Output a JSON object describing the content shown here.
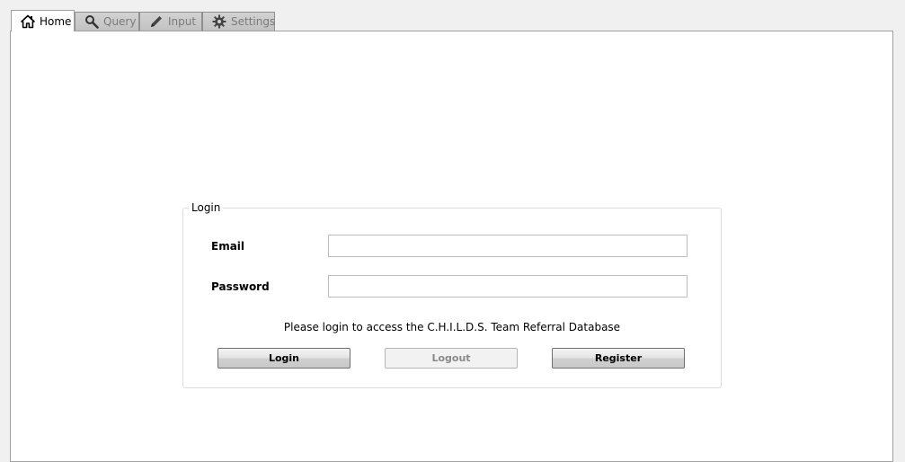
{
  "tabs": [
    {
      "label": "Home",
      "icon": "home-icon",
      "active": true
    },
    {
      "label": "Query",
      "icon": "search-icon",
      "active": false
    },
    {
      "label": "Input",
      "icon": "pencil-icon",
      "active": false
    },
    {
      "label": "Settings",
      "icon": "gear-icon",
      "active": false
    }
  ],
  "login": {
    "group_title": "Login",
    "email_label": "Email",
    "email_value": "",
    "password_label": "Password",
    "password_value": "",
    "message": "Please login to access the C.H.I.L.D.S. Team Referral Database",
    "login_button": "Login",
    "logout_button": "Logout",
    "register_button": "Register",
    "logout_enabled": false
  },
  "colors": {
    "window_background": "#f0f0f0",
    "pane_background": "#ffffff",
    "inactive_tab": "#c8c8c8",
    "disabled_text": "#8a8a8a"
  }
}
